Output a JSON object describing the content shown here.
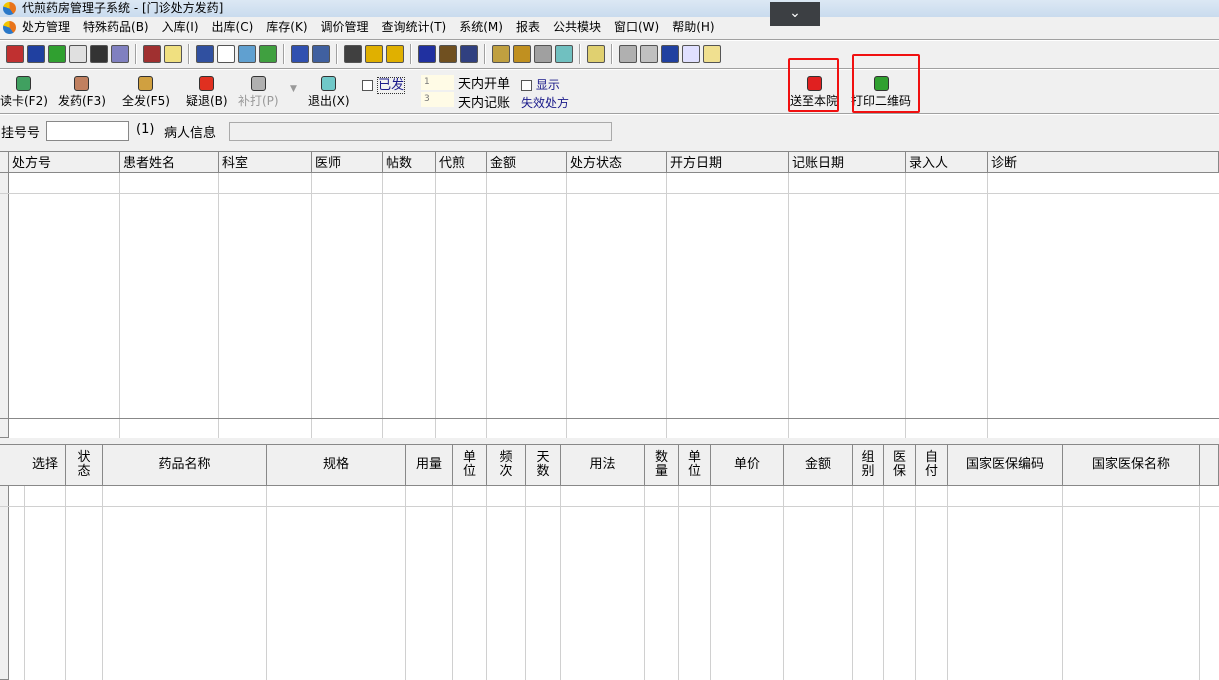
{
  "window": {
    "title": "代煎药房管理子系统 - [门诊处方发药]",
    "collapse_icon": "chevron-down-icon"
  },
  "menu": [
    "处方管理",
    "特殊药品(B)",
    "入库(I)",
    "出库(C)",
    "库存(K)",
    "调价管理",
    "查询统计(T)",
    "系统(M)",
    "报表",
    "公共模块",
    "窗口(W)",
    "帮助(H)"
  ],
  "toolbar_icons": [
    {
      "name": "patient-card-icon",
      "color": "#c03030"
    },
    {
      "name": "bottle-icon",
      "color": "#2040a0"
    },
    {
      "name": "check-icon",
      "color": "#30a030"
    },
    {
      "name": "document-icon",
      "color": "#e0e0e0"
    },
    {
      "name": "binoculars-icon",
      "color": "#333333"
    },
    {
      "name": "calculator-icon",
      "color": "#8080c0"
    },
    "|",
    {
      "name": "report-icon",
      "color": "#a03030"
    },
    {
      "name": "new-item-icon",
      "color": "#f0e080"
    },
    "|",
    {
      "name": "edit-document-icon",
      "color": "#3050a0"
    },
    {
      "name": "checkmark-icon",
      "color": "#ffffff"
    },
    {
      "name": "clipboard-icon",
      "color": "#60a0d0"
    },
    {
      "name": "verify-icon",
      "color": "#40a040"
    },
    "|",
    {
      "name": "calendar-edit-icon",
      "color": "#3050b0"
    },
    {
      "name": "table-icon",
      "color": "#4060a0"
    },
    "|",
    {
      "name": "grid-icon",
      "color": "#404040"
    },
    {
      "name": "bell-icon",
      "color": "#e0b000"
    },
    {
      "name": "pm-icon",
      "color": "#e0b000"
    },
    "|",
    {
      "name": "trash-icon",
      "color": "#2030a0"
    },
    {
      "name": "find-icon",
      "color": "#705020"
    },
    {
      "name": "find-table-icon",
      "color": "#304080"
    },
    "|",
    {
      "name": "folder-icon",
      "color": "#c0a040"
    },
    {
      "name": "thermometer-icon",
      "color": "#c09020"
    },
    {
      "name": "magnifier-icon",
      "color": "#a0a0a0"
    },
    {
      "name": "close-box-icon",
      "color": "#70c0c0"
    },
    "|",
    {
      "name": "open-folder-icon",
      "color": "#e0d070"
    },
    "|",
    {
      "name": "disabled-icon",
      "color": "#b0b0b0"
    },
    {
      "name": "zoom-icon",
      "color": "#c0c0c0"
    },
    {
      "name": "windows-icon",
      "color": "#2040a0"
    },
    {
      "name": "review-icon",
      "color": "#e0e0ff"
    },
    {
      "name": "paste-icon",
      "color": "#f0e090"
    }
  ],
  "actions": {
    "read_card": {
      "label": "读卡(F2)",
      "icon": "card-reader-icon",
      "color": "#40a060"
    },
    "dispense": {
      "label": "发药(F3)",
      "icon": "medicine-bag-icon",
      "color": "#c08060"
    },
    "dispense_all": {
      "label": "全发(F5)",
      "icon": "books-icon",
      "color": "#d0a040"
    },
    "suspect_return": {
      "label": "疑退(B)",
      "icon": "no-entry-icon",
      "color": "#e03020"
    },
    "reprint": {
      "label": "补打(P)",
      "icon": "printer-icon",
      "color": "#b0b0b0"
    },
    "exit": {
      "label": "退出(X)",
      "icon": "exit-icon",
      "color": "#70c8c8"
    },
    "send_to_hospital": {
      "label": "送至本院",
      "icon": "send-arrow-icon",
      "color": "#e02020"
    },
    "print_qr": {
      "label": "打印二维码",
      "icon": "printer-icon",
      "color": "#30a030"
    }
  },
  "filters": {
    "dispensed_label": "已发",
    "dispensed_checked": false,
    "days_open_value": "1",
    "days_open_label": "天内开单",
    "show_label": "显示",
    "show_checked": false,
    "days_bill_value": "3",
    "days_bill_label": "天内记账",
    "invalid_label": "失效处方"
  },
  "registration": {
    "label": "挂号号",
    "value": "",
    "hint": "(1)",
    "patient_label": "病人信息",
    "patient_value": ""
  },
  "prescription_table": {
    "columns": [
      "处方号",
      "患者姓名",
      "科室",
      "医师",
      "帖数",
      "代煎",
      "金额",
      "处方状态",
      "开方日期",
      "记账日期",
      "录入人",
      "诊断"
    ],
    "rows": []
  },
  "drug_table": {
    "columns": [
      "",
      "选择",
      "状态",
      "药品名称",
      "规格",
      "用量",
      "单位",
      "频次",
      "天数",
      "用法",
      "数量",
      "单位",
      "单价",
      "金额",
      "组别",
      "医保",
      "自付",
      "国家医保编码",
      "国家医保名称",
      ""
    ],
    "rows": []
  }
}
